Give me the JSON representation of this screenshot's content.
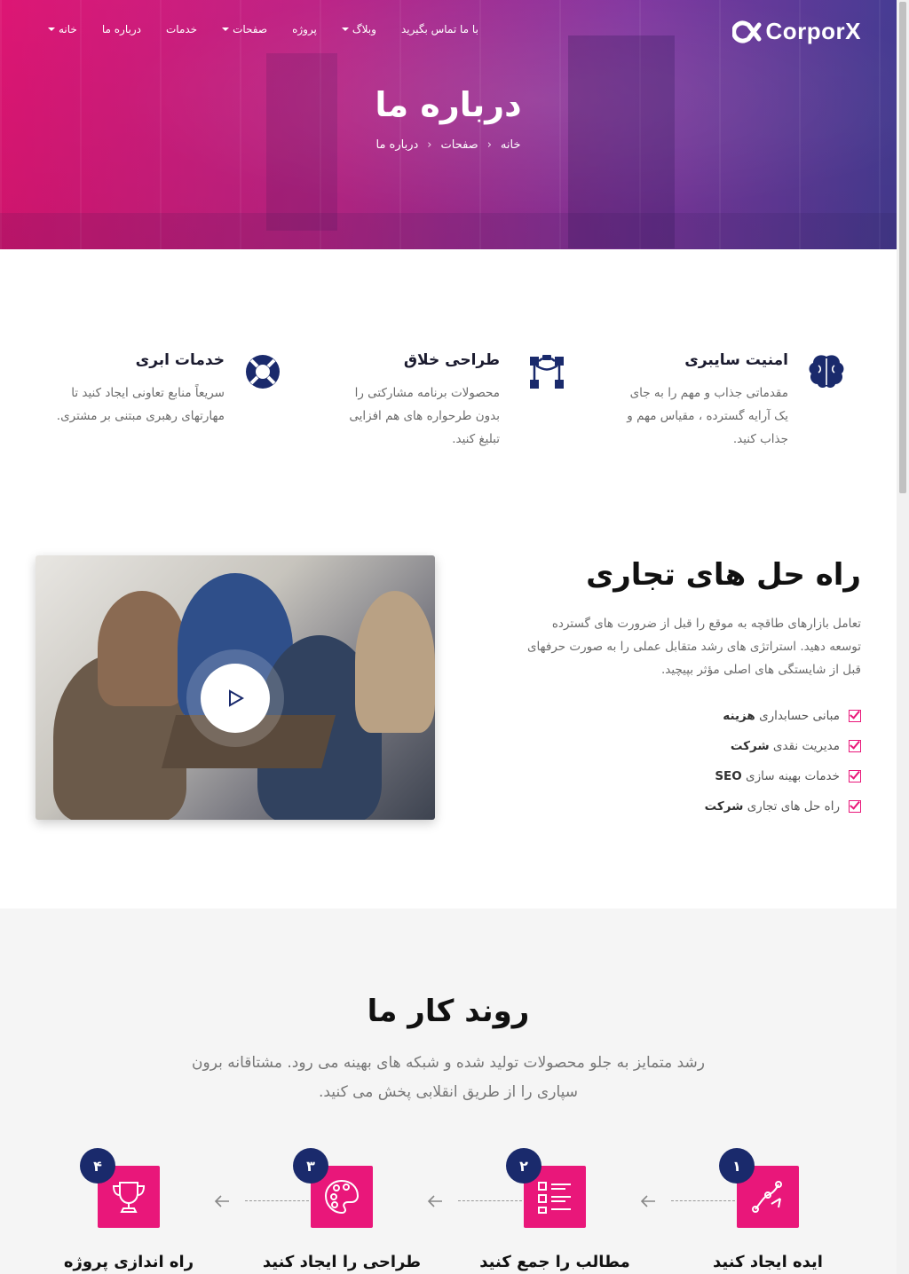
{
  "header": {
    "logo_text": "CorporX",
    "nav": [
      {
        "label": "خانه",
        "dropdown": true
      },
      {
        "label": "درباره ما",
        "dropdown": false
      },
      {
        "label": "خدمات",
        "dropdown": false
      },
      {
        "label": "صفحات",
        "dropdown": true
      },
      {
        "label": "پروژه",
        "dropdown": false
      },
      {
        "label": "وبلاگ",
        "dropdown": true
      },
      {
        "label": "با ما تماس بگیرید",
        "dropdown": false
      }
    ]
  },
  "hero": {
    "title": "درباره ما",
    "breadcrumb": [
      "خانه",
      "صفحات",
      "درباره ما"
    ]
  },
  "features": [
    {
      "icon": "brain-icon",
      "title": "امنیت سایبری",
      "text": "مقدماتی جذاب و مهم را به جای یک آرایه گسترده ، مقیاس مهم و جذاب کنید."
    },
    {
      "icon": "nodes-icon",
      "title": "طراحی خلاق",
      "text": "محصولات برنامه مشارکتی را بدون طرحواره های هم افزایی تبلیغ کنید."
    },
    {
      "icon": "lifebuoy-icon",
      "title": "خدمات ابری",
      "text": "سریعاً منابع تعاونی ایجاد کنید تا مهارتهای رهبری مبتنی بر مشتری."
    }
  ],
  "business": {
    "title": "راه حل های تجاری",
    "text": "تعامل بازارهای طاقچه به موقع را قبل از ضرورت های گسترده توسعه دهید. استراتژی های رشد متقابل عملی را به صورت حرفهای قبل از شایستگی های اصلی مؤثر بپیچید.",
    "list": [
      {
        "normal": "مبانی حسابداری ",
        "bold": "هزینه"
      },
      {
        "normal": "مدیریت نقدی ",
        "bold": "شرکت"
      },
      {
        "normal": "خدمات بهینه سازی ",
        "bold": "SEO"
      },
      {
        "normal": "راه حل های تجاری ",
        "bold": "شرکت"
      }
    ],
    "video_icon": "play-icon"
  },
  "process": {
    "title": "روند کار ما",
    "text": "رشد متمایز به جلو محصولات تولید شده و شبکه های بهینه می رود. مشتاقانه برون سپاری را از طریق انقلابی پخش می کنید.",
    "steps": [
      {
        "num": "۱",
        "title": "ایده ایجاد کنید",
        "icon": "vector-pen-icon"
      },
      {
        "num": "۲",
        "title": "مطالب را جمع کنید",
        "icon": "list-icon"
      },
      {
        "num": "۳",
        "title": "طراحی را ایجاد کنید",
        "icon": "palette-icon"
      },
      {
        "num": "۴",
        "title": "راه اندازی پروژه",
        "icon": "trophy-icon"
      }
    ]
  },
  "colors": {
    "accent": "#e9177a",
    "navy": "#1a2a6c",
    "hero_gradient_start": "#e9177a",
    "hero_gradient_end": "#4a3f9b"
  }
}
